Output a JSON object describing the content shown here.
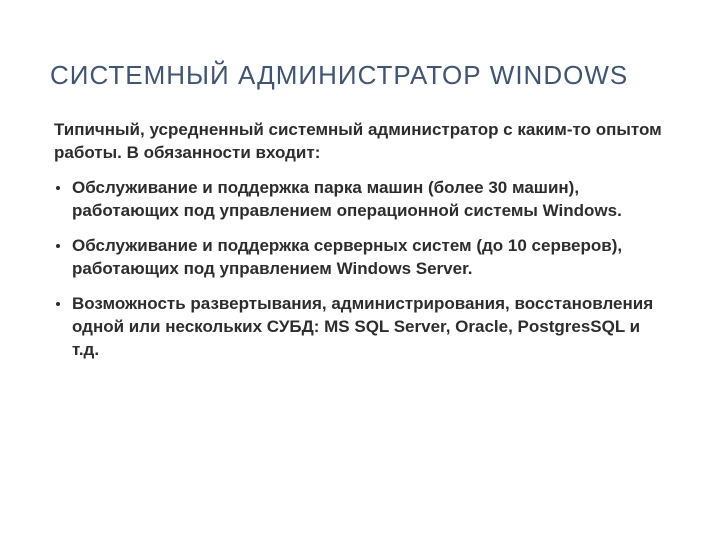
{
  "slide": {
    "title": "СИСТЕМНЫЙ АДМИНИСТРАТОР WINDOWS",
    "intro": "Типичный, усредненный системный администратор с каким-то опытом работы. В обязанности входит:",
    "bullets": [
      "Обслуживание и поддержка парка машин (более 30 машин), работающих под управлением операционной системы Windows.",
      "Обслуживание и поддержка серверных систем (до 10 серверов), работающих под управлением Windows Server.",
      "Возможность развертывания, администрирования, восстановления одной или нескольких СУБД: MS SQL Server, Oracle, PostgresSQL и т.д."
    ]
  },
  "colors": {
    "title": "#3f5577",
    "text": "#2d2d2d",
    "background": "#ffffff"
  }
}
